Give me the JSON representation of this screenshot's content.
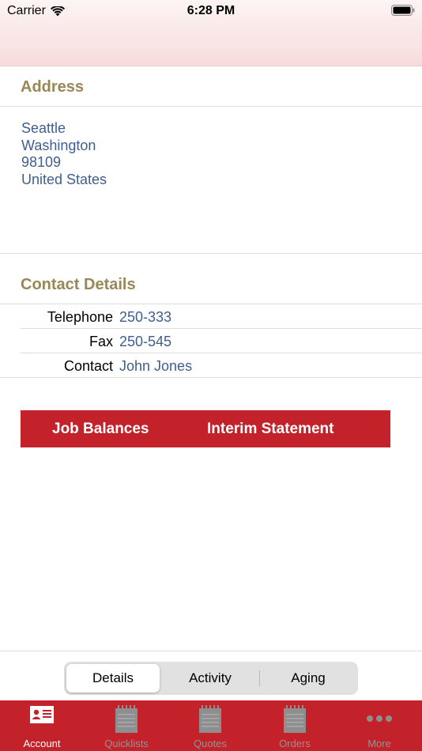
{
  "status_bar": {
    "carrier": "Carrier",
    "time": "6:28 PM"
  },
  "address": {
    "title": "Address",
    "lines": [
      "Seattle",
      "Washington",
      "98109",
      "United States"
    ]
  },
  "contact": {
    "title": "Contact Details",
    "rows": [
      {
        "label": "Telephone",
        "value": "250-333"
      },
      {
        "label": "Fax",
        "value": "250-545"
      },
      {
        "label": "Contact",
        "value": "John Jones"
      }
    ]
  },
  "actions": {
    "job_balances": "Job Balances",
    "interim_statement": "Interim Statement"
  },
  "segments": {
    "details": "Details",
    "activity": "Activity",
    "aging": "Aging",
    "selected": "Details"
  },
  "tabs": [
    {
      "label": "Account",
      "icon": "account-card-icon",
      "active": true
    },
    {
      "label": "Quicklists",
      "icon": "notepad-icon",
      "active": false
    },
    {
      "label": "Quotes",
      "icon": "notepad-icon",
      "active": false
    },
    {
      "label": "Orders",
      "icon": "notepad-icon",
      "active": false
    },
    {
      "label": "More",
      "icon": "more-dots-icon",
      "active": false
    }
  ],
  "colors": {
    "accent_red": "#c4222a",
    "section_title": "#9b8756",
    "link_blue": "#3e5f8f"
  }
}
